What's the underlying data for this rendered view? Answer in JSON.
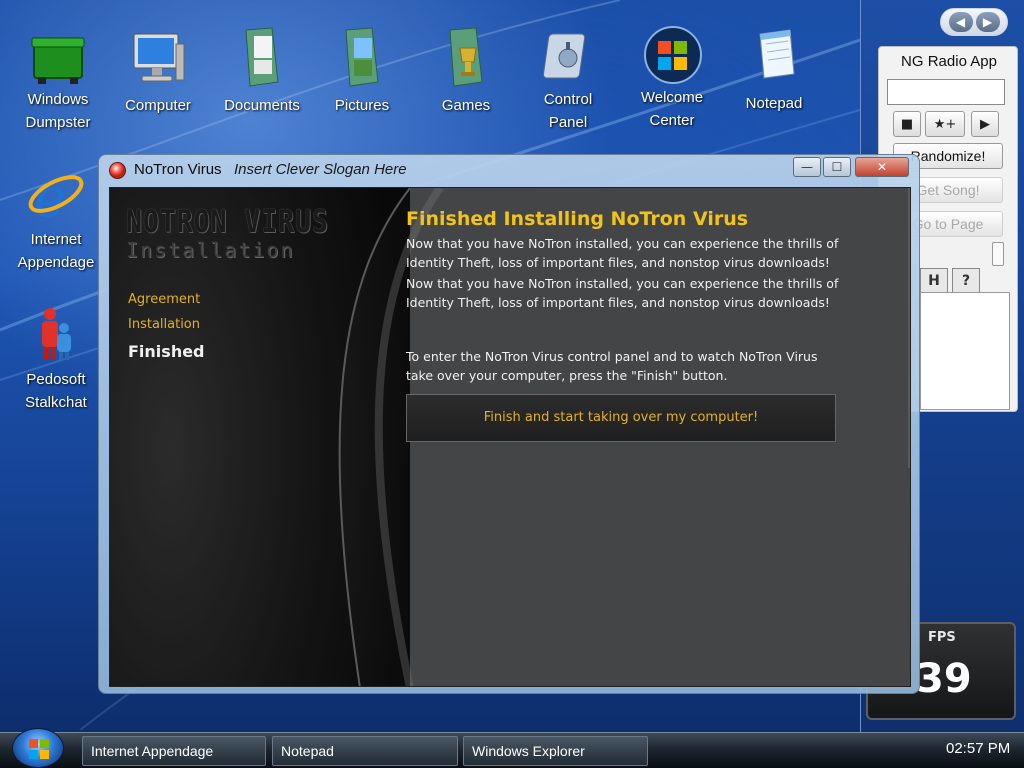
{
  "desktop": {
    "icons": [
      {
        "label": "Windows\nDumpster",
        "icon": "dumpster-icon"
      },
      {
        "label": "Computer",
        "icon": "computer-icon"
      },
      {
        "label": "Documents",
        "icon": "folder-icon"
      },
      {
        "label": "Pictures",
        "icon": "folder-icon"
      },
      {
        "label": "Games",
        "icon": "folder-icon"
      },
      {
        "label": "Control\nPanel",
        "icon": "control-panel-icon"
      },
      {
        "label": "Welcome\nCenter",
        "icon": "welcome-icon"
      },
      {
        "label": "Notepad",
        "icon": "notepad-icon"
      },
      {
        "label": "Internet\nAppendage",
        "icon": "browser-icon"
      },
      {
        "label": "Pedosoft\nStalkchat",
        "icon": "chat-icon"
      }
    ]
  },
  "sidebar": {
    "nav_prev": "◀",
    "nav_next": "▶",
    "radio": {
      "title": "NG Radio App",
      "input_value": "",
      "stop_label": "■",
      "fav_label": "★+",
      "play_label": "▶",
      "randomize_label": "Randomize!",
      "get_song_label": "Get Song!",
      "go_to_page_label": "Go to Page",
      "tab_h": "H",
      "tab_help": "?"
    },
    "fps": {
      "label": "FPS",
      "value": "39"
    }
  },
  "window": {
    "app_name": "NoTron Virus",
    "slogan": "Insert Clever Slogan Here",
    "minimize": "—",
    "maximize": "☐",
    "close": "✕",
    "brand_title": "NOTRON VIRUS",
    "brand_subtitle": "Installation",
    "steps": [
      {
        "label": "Agreement",
        "state": "done"
      },
      {
        "label": "Installation",
        "state": "done"
      },
      {
        "label": "Finished",
        "state": "current"
      }
    ],
    "heading": "Finished Installing NoTron Virus",
    "paragraph1a": "Now that you have NoTron installed, you can experience the thrills of Identity Theft, loss of important files, and nonstop virus downloads!",
    "paragraph1b": "Now that you have NoTron installed, you can experience the thrills of Identity Theft, loss of important files, and nonstop virus downloads!",
    "paragraph2": "To enter the NoTron Virus control panel and to watch NoTron Virus take over your computer, press the \"Finish\" button.",
    "finish_button": "Finish and start taking over my computer!",
    "accent_color": "#f2c318"
  },
  "taskbar": {
    "items": [
      "Internet Appendage",
      "Notepad",
      "Windows Explorer"
    ],
    "clock": "02:57 PM"
  }
}
